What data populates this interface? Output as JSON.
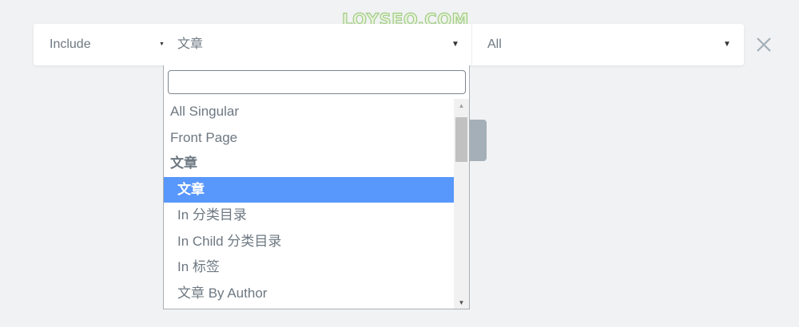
{
  "watermark": "LOYSEO.COM",
  "condition": {
    "type_value": "Include",
    "sub_name_value": "文章",
    "sub_id_value": "All",
    "remove_glyph": "✕"
  },
  "dropdown": {
    "search_value": "",
    "options": [
      {
        "label": "All Singular",
        "kind": "option"
      },
      {
        "label": "Front Page",
        "kind": "option"
      },
      {
        "label": "文章",
        "kind": "group"
      },
      {
        "label": "文章",
        "kind": "child",
        "selected": true
      },
      {
        "label": "In 分类目录",
        "kind": "child"
      },
      {
        "label": "In Child 分类目录",
        "kind": "child"
      },
      {
        "label": "In 标签",
        "kind": "child"
      },
      {
        "label": "文章 By Author",
        "kind": "child"
      }
    ],
    "selected_color": "#5897fb"
  },
  "icons": {
    "arrow": "caret-down-icon",
    "remove": "close-icon",
    "scroll_up": "scroll-up-arrow-icon",
    "scroll_down": "scroll-down-arrow-icon"
  }
}
